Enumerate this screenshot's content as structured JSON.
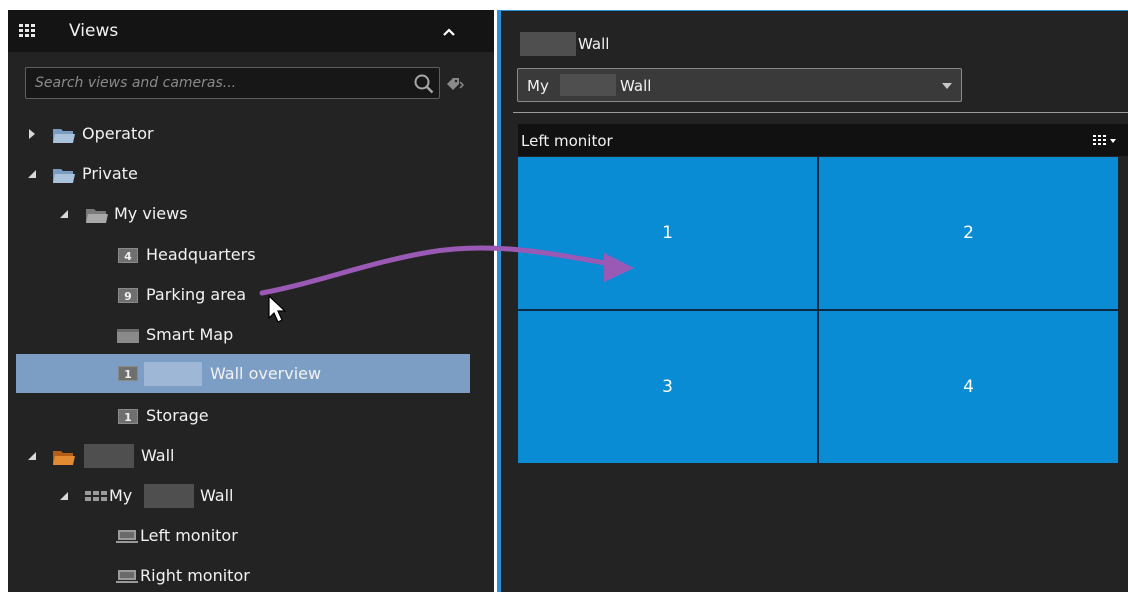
{
  "views_panel": {
    "title": "Views",
    "search": {
      "placeholder": "Search views and cameras..."
    },
    "tree": {
      "operator": "Operator",
      "private": "Private",
      "my_views": "My views",
      "headquarters": {
        "badge": "4",
        "label": "Headquarters"
      },
      "parking_area": {
        "badge": "9",
        "label": "Parking area"
      },
      "smart_map": "Smart Map",
      "wall_overview": {
        "badge": "1",
        "label": "Wall overview"
      },
      "storage": {
        "badge": "1",
        "label": "Storage"
      },
      "wall_folder": "Wall",
      "my_wall": {
        "prefix": "My",
        "suffix": "Wall"
      },
      "left_monitor": "Left monitor",
      "right_monitor": "Right monitor"
    }
  },
  "wall_panel": {
    "title": "Wall",
    "dropdown": {
      "prefix": "My",
      "suffix": "Wall"
    },
    "monitor": {
      "title": "Left monitor",
      "cells": [
        "1",
        "2",
        "3",
        "4"
      ]
    }
  },
  "colors": {
    "panel_bg": "#232323",
    "header_bg": "#141414",
    "accent_blue": "#2a8fd6",
    "cell_blue": "#0a8cd4",
    "selection": "#7c9dc4",
    "arrow": "#9b59b6",
    "folder_gray": "#9a9a9a",
    "folder_orange": "#e07b24"
  }
}
